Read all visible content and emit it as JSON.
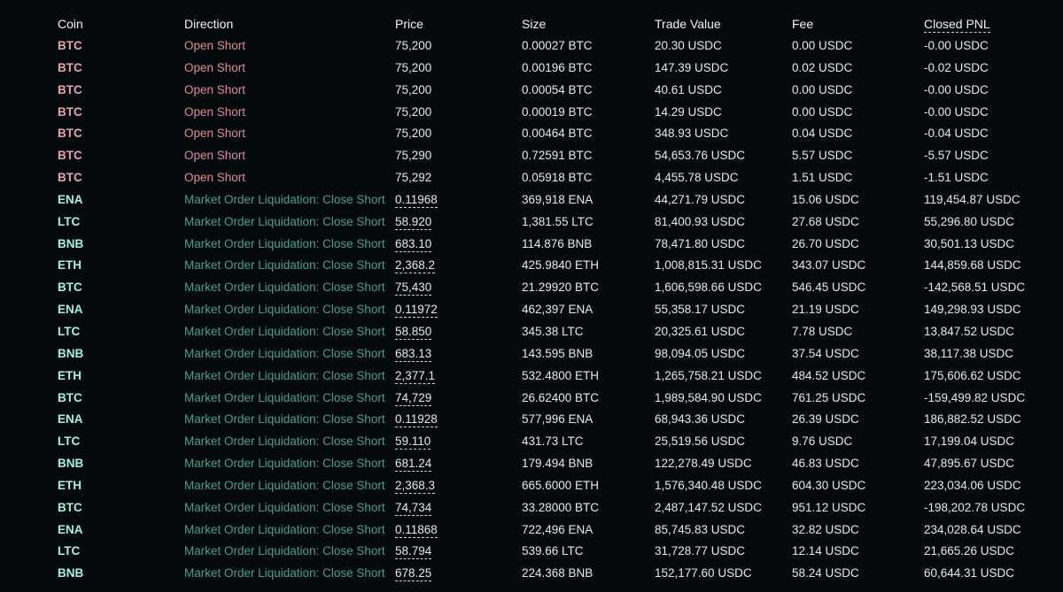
{
  "columns": {
    "coin": "Coin",
    "direction": "Direction",
    "price": "Price",
    "size": "Size",
    "trade_value": "Trade Value",
    "fee": "Fee",
    "closed_pnl": "Closed PNL"
  },
  "colors": {
    "background": "#04090b",
    "short_coin": "#e8a3b3",
    "short_direction": "#e08b99",
    "liquidation_coin": "#a7f0e4",
    "liquidation_direction": "#4e9f88"
  },
  "rows": [
    {
      "coin": "BTC",
      "direction": "Open Short",
      "kind": "short",
      "price": "75,200",
      "size": "0.00027 BTC",
      "trade_value": "20.30 USDC",
      "fee": "0.00 USDC",
      "closed_pnl": "-0.00 USDC"
    },
    {
      "coin": "BTC",
      "direction": "Open Short",
      "kind": "short",
      "price": "75,200",
      "size": "0.00196 BTC",
      "trade_value": "147.39 USDC",
      "fee": "0.02 USDC",
      "closed_pnl": "-0.02 USDC"
    },
    {
      "coin": "BTC",
      "direction": "Open Short",
      "kind": "short",
      "price": "75,200",
      "size": "0.00054 BTC",
      "trade_value": "40.61 USDC",
      "fee": "0.00 USDC",
      "closed_pnl": "-0.00 USDC"
    },
    {
      "coin": "BTC",
      "direction": "Open Short",
      "kind": "short",
      "price": "75,200",
      "size": "0.00019 BTC",
      "trade_value": "14.29 USDC",
      "fee": "0.00 USDC",
      "closed_pnl": "-0.00 USDC"
    },
    {
      "coin": "BTC",
      "direction": "Open Short",
      "kind": "short",
      "price": "75,200",
      "size": "0.00464 BTC",
      "trade_value": "348.93 USDC",
      "fee": "0.04 USDC",
      "closed_pnl": "-0.04 USDC"
    },
    {
      "coin": "BTC",
      "direction": "Open Short",
      "kind": "short",
      "price": "75,290",
      "size": "0.72591 BTC",
      "trade_value": "54,653.76 USDC",
      "fee": "5.57 USDC",
      "closed_pnl": "-5.57 USDC"
    },
    {
      "coin": "BTC",
      "direction": "Open Short",
      "kind": "short",
      "price": "75,292",
      "size": "0.05918 BTC",
      "trade_value": "4,455.78 USDC",
      "fee": "1.51 USDC",
      "closed_pnl": "-1.51 USDC"
    },
    {
      "coin": "ENA",
      "direction": "Market Order Liquidation: Close Short",
      "kind": "liq",
      "price": "0.11968",
      "size": "369,918 ENA",
      "trade_value": "44,271.79 USDC",
      "fee": "15.06 USDC",
      "closed_pnl": "119,454.87 USDC"
    },
    {
      "coin": "LTC",
      "direction": "Market Order Liquidation: Close Short",
      "kind": "liq",
      "price": "58.920",
      "size": "1,381.55 LTC",
      "trade_value": "81,400.93 USDC",
      "fee": "27.68 USDC",
      "closed_pnl": "55,296.80 USDC"
    },
    {
      "coin": "BNB",
      "direction": "Market Order Liquidation: Close Short",
      "kind": "liq",
      "price": "683.10",
      "size": "114.876 BNB",
      "trade_value": "78,471.80 USDC",
      "fee": "26.70 USDC",
      "closed_pnl": "30,501.13 USDC"
    },
    {
      "coin": "ETH",
      "direction": "Market Order Liquidation: Close Short",
      "kind": "liq",
      "price": "2,368.2",
      "size": "425.9840 ETH",
      "trade_value": "1,008,815.31 USDC",
      "fee": "343.07 USDC",
      "closed_pnl": "144,859.68 USDC"
    },
    {
      "coin": "BTC",
      "direction": "Market Order Liquidation: Close Short",
      "kind": "liq",
      "price": "75,430",
      "size": "21.29920 BTC",
      "trade_value": "1,606,598.66 USDC",
      "fee": "546.45 USDC",
      "closed_pnl": "-142,568.51 USDC"
    },
    {
      "coin": "ENA",
      "direction": "Market Order Liquidation: Close Short",
      "kind": "liq",
      "price": "0.11972",
      "size": "462,397 ENA",
      "trade_value": "55,358.17 USDC",
      "fee": "21.19 USDC",
      "closed_pnl": "149,298.93 USDC"
    },
    {
      "coin": "LTC",
      "direction": "Market Order Liquidation: Close Short",
      "kind": "liq",
      "price": "58.850",
      "size": "345.38 LTC",
      "trade_value": "20,325.61 USDC",
      "fee": "7.78 USDC",
      "closed_pnl": "13,847.52 USDC"
    },
    {
      "coin": "BNB",
      "direction": "Market Order Liquidation: Close Short",
      "kind": "liq",
      "price": "683.13",
      "size": "143.595 BNB",
      "trade_value": "98,094.05 USDC",
      "fee": "37.54 USDC",
      "closed_pnl": "38,117.38 USDC"
    },
    {
      "coin": "ETH",
      "direction": "Market Order Liquidation: Close Short",
      "kind": "liq",
      "price": "2,377.1",
      "size": "532.4800 ETH",
      "trade_value": "1,265,758.21 USDC",
      "fee": "484.52 USDC",
      "closed_pnl": "175,606.62 USDC"
    },
    {
      "coin": "BTC",
      "direction": "Market Order Liquidation: Close Short",
      "kind": "liq",
      "price": "74,729",
      "size": "26.62400 BTC",
      "trade_value": "1,989,584.90 USDC",
      "fee": "761.25 USDC",
      "closed_pnl": "-159,499.82 USDC"
    },
    {
      "coin": "ENA",
      "direction": "Market Order Liquidation: Close Short",
      "kind": "liq",
      "price": "0.11928",
      "size": "577,996 ENA",
      "trade_value": "68,943.36 USDC",
      "fee": "26.39 USDC",
      "closed_pnl": "186,882.52 USDC"
    },
    {
      "coin": "LTC",
      "direction": "Market Order Liquidation: Close Short",
      "kind": "liq",
      "price": "59.110",
      "size": "431.73 LTC",
      "trade_value": "25,519.56 USDC",
      "fee": "9.76 USDC",
      "closed_pnl": "17,199.04 USDC"
    },
    {
      "coin": "BNB",
      "direction": "Market Order Liquidation: Close Short",
      "kind": "liq",
      "price": "681.24",
      "size": "179.494 BNB",
      "trade_value": "122,278.49 USDC",
      "fee": "46.83 USDC",
      "closed_pnl": "47,895.67 USDC"
    },
    {
      "coin": "ETH",
      "direction": "Market Order Liquidation: Close Short",
      "kind": "liq",
      "price": "2,368.3",
      "size": "665.6000 ETH",
      "trade_value": "1,576,340.48 USDC",
      "fee": "604.30 USDC",
      "closed_pnl": "223,034.06 USDC"
    },
    {
      "coin": "BTC",
      "direction": "Market Order Liquidation: Close Short",
      "kind": "liq",
      "price": "74,734",
      "size": "33.28000 BTC",
      "trade_value": "2,487,147.52 USDC",
      "fee": "951.12 USDC",
      "closed_pnl": "-198,202.78 USDC"
    },
    {
      "coin": "ENA",
      "direction": "Market Order Liquidation: Close Short",
      "kind": "liq",
      "price": "0.11868",
      "size": "722,496 ENA",
      "trade_value": "85,745.83 USDC",
      "fee": "32.82 USDC",
      "closed_pnl": "234,028.64 USDC"
    },
    {
      "coin": "LTC",
      "direction": "Market Order Liquidation: Close Short",
      "kind": "liq",
      "price": "58.794",
      "size": "539.66 LTC",
      "trade_value": "31,728.77 USDC",
      "fee": "12.14 USDC",
      "closed_pnl": "21,665.26 USDC"
    },
    {
      "coin": "BNB",
      "direction": "Market Order Liquidation: Close Short",
      "kind": "liq",
      "price": "678.25",
      "size": "224.368 BNB",
      "trade_value": "152,177.60 USDC",
      "fee": "58.24 USDC",
      "closed_pnl": "60,644.31 USDC"
    }
  ]
}
